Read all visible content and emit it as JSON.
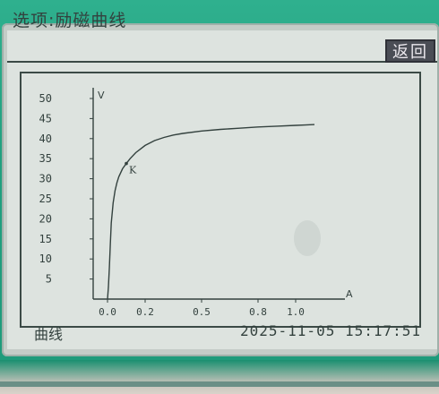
{
  "header": {
    "title": "选项:励磁曲线",
    "back_label": "返回"
  },
  "footer": {
    "label": "曲线",
    "datetime": "2025-11-05 15:17:51"
  },
  "colors": {
    "screen_bg": "#dde3df",
    "ink": "#33413e",
    "button_bg": "#4a4d55",
    "bezel": "#21a07f"
  },
  "chart_data": {
    "type": "line",
    "xlabel": "A",
    "ylabel": "V",
    "xlim": [
      0.0,
      1.2
    ],
    "ylim": [
      0,
      50
    ],
    "x_ticks": [
      0.0,
      0.2,
      0.5,
      0.8,
      1.0
    ],
    "x_tick_labels": [
      "0.0",
      "0.2",
      "0.5",
      "0.8",
      "1.0"
    ],
    "y_ticks": [
      5,
      10,
      15,
      20,
      25,
      30,
      35,
      40,
      45,
      50
    ],
    "y_tick_labels": [
      "5",
      "10",
      "15",
      "20",
      "25",
      "30",
      "35",
      "40",
      "45",
      "50"
    ],
    "grid": false,
    "series": [
      {
        "points": [
          [
            0.0,
            0.0
          ],
          [
            0.005,
            3
          ],
          [
            0.01,
            8
          ],
          [
            0.015,
            14
          ],
          [
            0.02,
            19
          ],
          [
            0.03,
            24
          ],
          [
            0.04,
            27
          ],
          [
            0.05,
            29
          ],
          [
            0.06,
            30.5
          ],
          [
            0.08,
            32.5
          ],
          [
            0.1,
            33.8
          ],
          [
            0.12,
            35
          ],
          [
            0.15,
            36.5
          ],
          [
            0.2,
            38.3
          ],
          [
            0.25,
            39.5
          ],
          [
            0.3,
            40.3
          ],
          [
            0.35,
            40.9
          ],
          [
            0.4,
            41.3
          ],
          [
            0.5,
            41.9
          ],
          [
            0.6,
            42.3
          ],
          [
            0.7,
            42.6
          ],
          [
            0.8,
            42.9
          ],
          [
            0.9,
            43.1
          ],
          [
            1.0,
            43.3
          ],
          [
            1.05,
            43.4
          ],
          [
            1.1,
            43.5
          ]
        ]
      }
    ],
    "annotations": [
      {
        "label": "K",
        "x": 0.1,
        "y": 33.8
      }
    ]
  }
}
